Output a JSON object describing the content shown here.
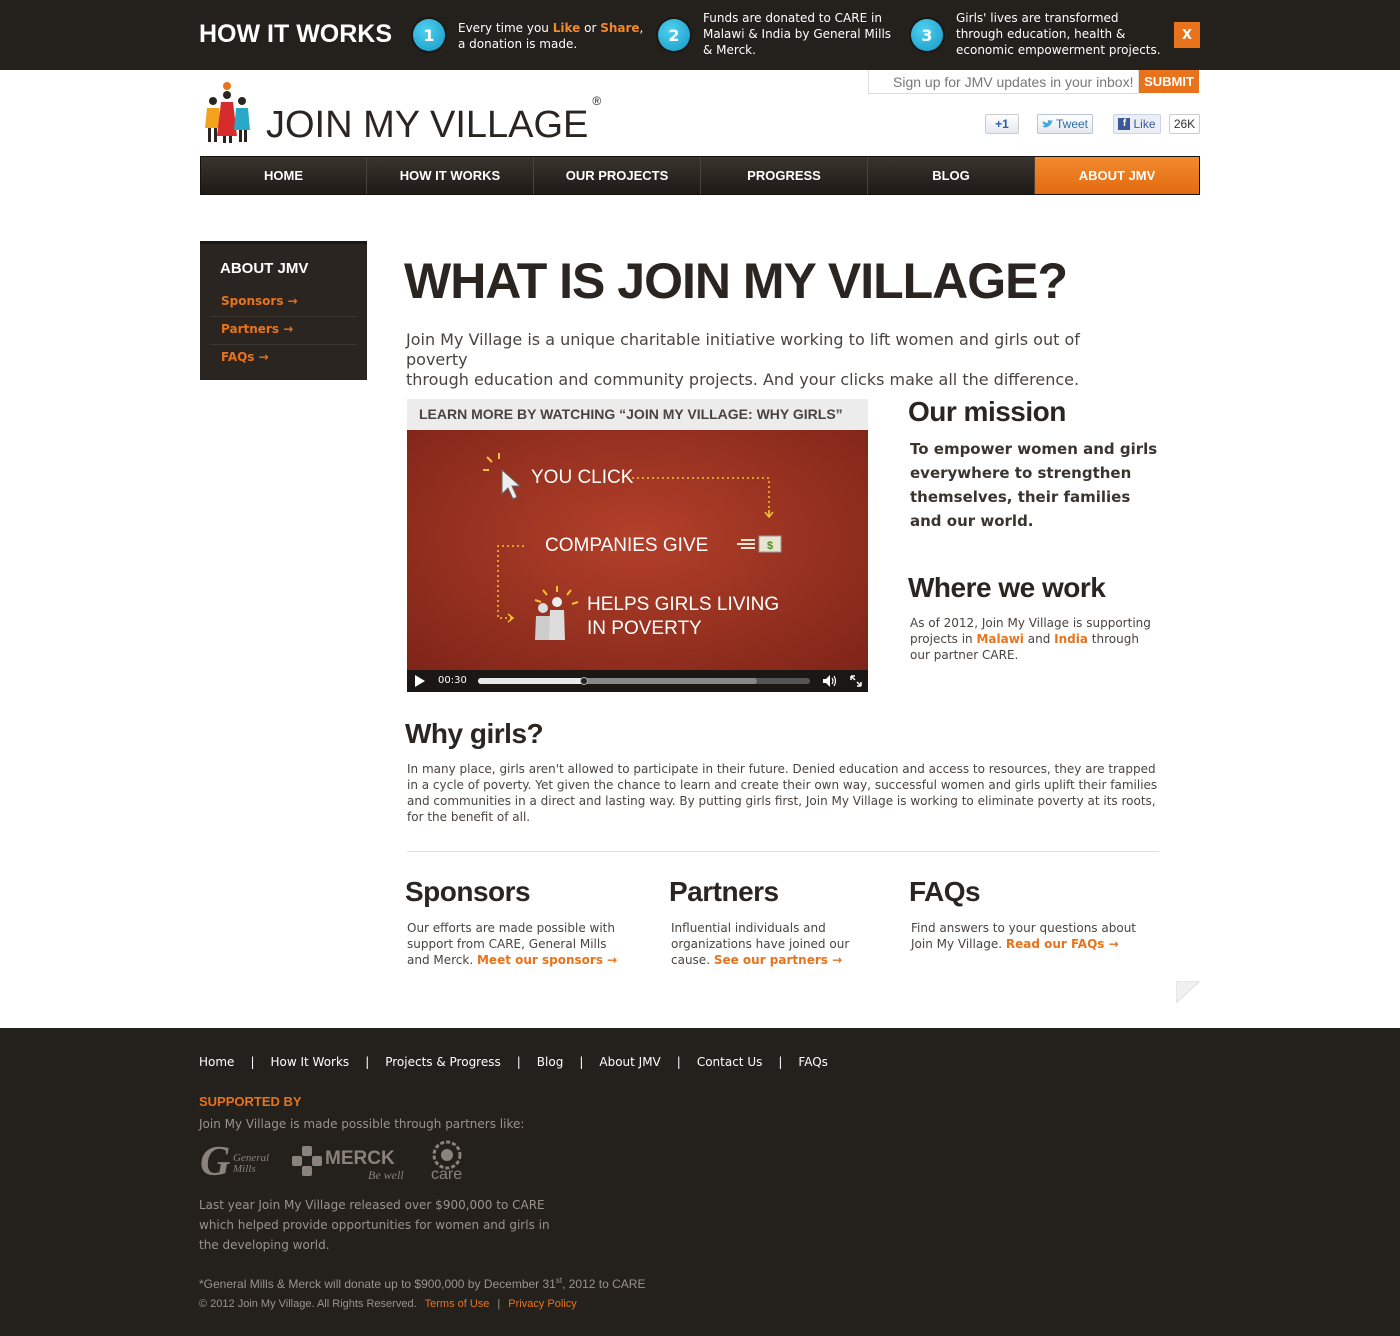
{
  "how_it_works": {
    "title": "HOW IT WORKS",
    "steps": [
      {
        "num": "1",
        "pre": "Every time you ",
        "like": "Like",
        "mid": " or ",
        "share": "Share",
        "post": ",",
        "line2": "a donation is made."
      },
      {
        "num": "2",
        "line1": "Funds are donated to CARE in",
        "line2": "Malawi & India by General Mills",
        "line3": "& Merck."
      },
      {
        "num": "3",
        "line1": "Girls' lives are transformed",
        "line2": "through education, health &",
        "line3": "economic empowerment projects."
      }
    ],
    "close_label": "X"
  },
  "header": {
    "signup_placeholder": "Sign up for JMV updates in your inbox!",
    "submit_label": "SUBMIT",
    "brand": "JOIN MY VILLAGE",
    "brand_mark": "®",
    "gplus_label": "+1",
    "tweet_label": "Tweet",
    "like_label": "Like",
    "like_count": "26K"
  },
  "nav": [
    {
      "label": "HOME",
      "active": false
    },
    {
      "label": "HOW IT WORKS",
      "active": false
    },
    {
      "label": "OUR PROJECTS",
      "active": false
    },
    {
      "label": "PROGRESS",
      "active": false
    },
    {
      "label": "BLOG",
      "active": false
    },
    {
      "label": "ABOUT JMV",
      "active": true
    }
  ],
  "sidebar": {
    "title": "ABOUT JMV",
    "links": [
      "Sponsors →",
      "Partners →",
      "FAQs →"
    ]
  },
  "main": {
    "title": "WHAT IS JOIN MY VILLAGE?",
    "lead_1": "Join My Village is a unique charitable initiative working to lift women and girls out of poverty",
    "lead_2": "through education and community projects. And your clicks make all the difference.",
    "video": {
      "heading": "LEARN MORE BY WATCHING “JOIN MY VILLAGE: WHY GIRLS”",
      "line_click": "YOU CLICK",
      "line_give": "COMPANIES GIVE",
      "line_help_1": "HELPS GIRLS LIVING",
      "line_help_2": "IN POVERTY",
      "dollar": "$",
      "time": "00:30",
      "progress": 0.32,
      "buffered": 0.84
    },
    "mission": {
      "title": "Our mission",
      "text": "To empower women and girls everywhere to strengthen themselves, their families and our world."
    },
    "where": {
      "title": "Where we work",
      "pre": "As of 2012, Join My Village is supporting projects in ",
      "malawi": "Malawi",
      "and": " and ",
      "india": "India",
      "post": " through our partner CARE."
    },
    "why": {
      "title": "Why girls?",
      "text": "In many place, girls aren't allowed to participate in their future. Denied education and access to resources, they are trapped in a cycle of poverty. Yet given the chance to learn and create their own way, successful women and girls uplift their families and communities in a direct and lasting way. By putting girls first, Join My Village is working to eliminate poverty at its roots, for the benefit of all."
    },
    "sponsors": {
      "title": "Sponsors",
      "text": "Our efforts are made possible with support from CARE, General Mills and Merck. ",
      "link": "Meet our sponsors →"
    },
    "partners": {
      "title": "Partners",
      "text": "Influential individuals and organizations have joined our cause. ",
      "link": "See our partners →"
    },
    "faqs": {
      "title": "FAQs",
      "text": "Find answers to your questions about Join My Village. ",
      "link": "Read our FAQs →"
    }
  },
  "footer": {
    "nav": [
      "Home",
      "How It Works",
      "Projects & Progress",
      "Blog",
      "About JMV",
      "Contact Us",
      "FAQs"
    ],
    "nav_separator": "|",
    "supported_title": "SUPPORTED BY",
    "supported_sub": "Join My Village is made possible through partners like:",
    "logo_gm_1": "General",
    "logo_gm_2": "Mills",
    "logo_merck": "MERCK",
    "logo_merck_tag": "Be well",
    "logo_care": "care",
    "para": "Last year Join My Village released over $900,000 to CARE which helped provide opportunities for women and girls in the developing world.",
    "note_pre": "*General Mills & Merck will donate up to $900,000 by December 31",
    "note_sup": "st",
    "note_post": ", 2012 to CARE",
    "copyright": "© 2012 Join My Village.  All Rights Reserved.",
    "terms": "Terms of Use",
    "privacy": "Privacy Policy",
    "copy_sep": "|"
  },
  "colors": {
    "accent": "#e8731c",
    "dark": "#24201c",
    "video_red": "#a3361f",
    "step_blue": "#1596c4"
  }
}
